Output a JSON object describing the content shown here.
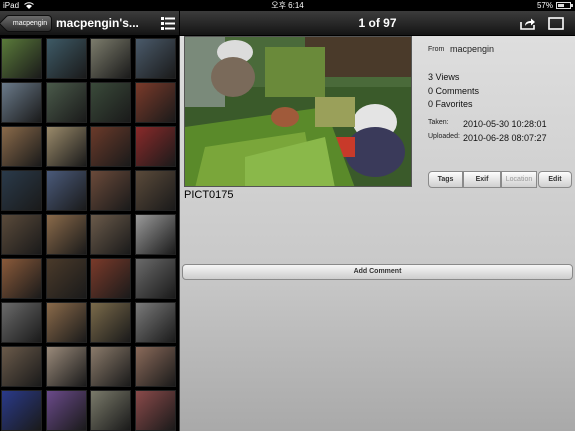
{
  "status_bar": {
    "carrier": "iPad",
    "time": "오후 6:14",
    "battery": "57%",
    "battery_level": 0.57
  },
  "left_nav": {
    "back_label": "macpengin",
    "title": "macpengin's..."
  },
  "right_nav": {
    "counter": "1 of 97"
  },
  "photo": {
    "caption": "PICT0175"
  },
  "info": {
    "from_label": "From",
    "from_value": "macpengin",
    "views": "3 Views",
    "comments": "0 Comments",
    "favorites": "0 Favorites",
    "taken_label": "Taken:",
    "taken_value": "2010-05-30 10:28:01",
    "uploaded_label": "Uploaded:",
    "uploaded_value": "2010-06-28 08:07:27"
  },
  "buttons": {
    "tags": "Tags",
    "exif": "Exif",
    "location": "Location",
    "edit": "Edit",
    "add_comment": "Add Comment"
  },
  "thumbnail_colors": [
    [
      "#5a7a3a",
      "#3e5a66",
      "#7c7c6c",
      "#4a5a6a"
    ],
    [
      "#6a7a8a",
      "#4a5a4a",
      "#3a4a3a",
      "#7a3a2a"
    ],
    [
      "#8a6a4a",
      "#9a8a6a",
      "#6a3a2a",
      "#8a2a2a"
    ],
    [
      "#2a3a4a",
      "#4a5a7a",
      "#6a4a3a",
      "#5a4a3a"
    ],
    [
      "#5a4a3a",
      "#8a6a4a",
      "#6a5a4a",
      "#9a9a9a"
    ],
    [
      "#8a5a3a",
      "#4a3a2a",
      "#7a3a2a",
      "#6a6a6a"
    ],
    [
      "#6a6a6a",
      "#8a6a4a",
      "#7a6a4a",
      "#7a7a7a"
    ],
    [
      "#6a5a4a",
      "#9a8a7a",
      "#8a7a6a",
      "#8a6a5a"
    ],
    [
      "#2a3a8a",
      "#6a4a8a",
      "#7a7a6a",
      "#8a4a4a"
    ]
  ]
}
